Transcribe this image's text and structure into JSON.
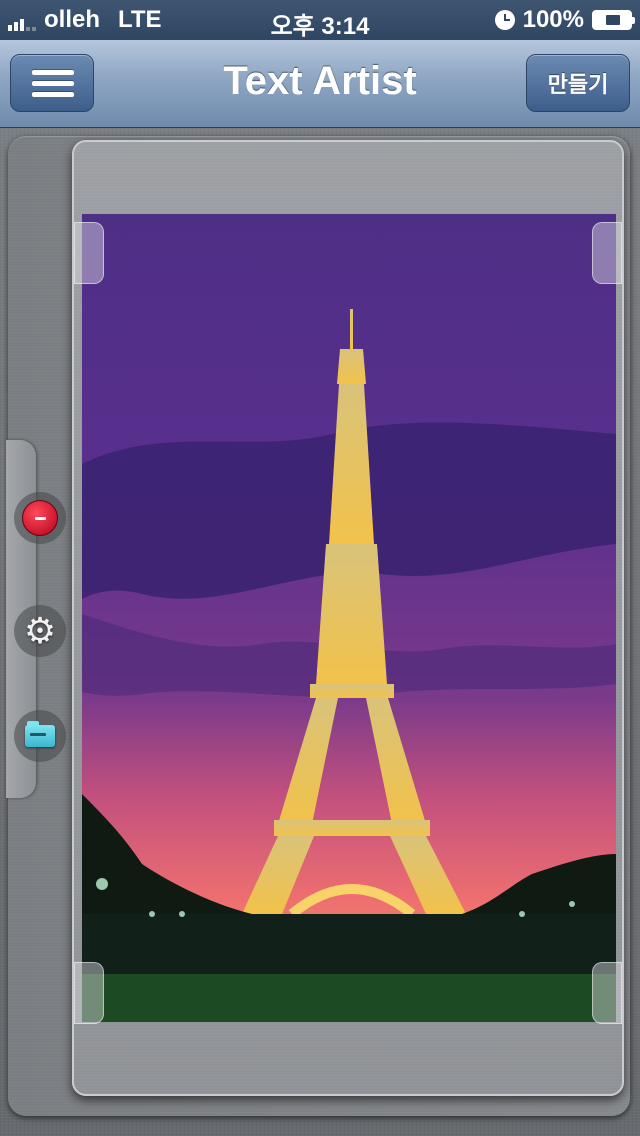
{
  "status_bar": {
    "carrier": "olleh",
    "network": "LTE",
    "time": "오후 3:14",
    "battery": "100%"
  },
  "nav_bar": {
    "title": "Text Artist",
    "create_label": "만들기"
  },
  "canvas": {
    "image_subject": "eiffel-tower-at-dusk"
  },
  "icons": {
    "menu": "hamburger-menu-icon",
    "remove": "remove-icon",
    "settings": "gear-icon",
    "open": "folder-icon"
  },
  "colors": {
    "nav_gradient_top": "#b4c6dc",
    "nav_gradient_bottom": "#6f8aad",
    "status_bar": "#2f4662",
    "remove_red": "#d0102a",
    "folder_cyan": "#4cc6dc"
  }
}
